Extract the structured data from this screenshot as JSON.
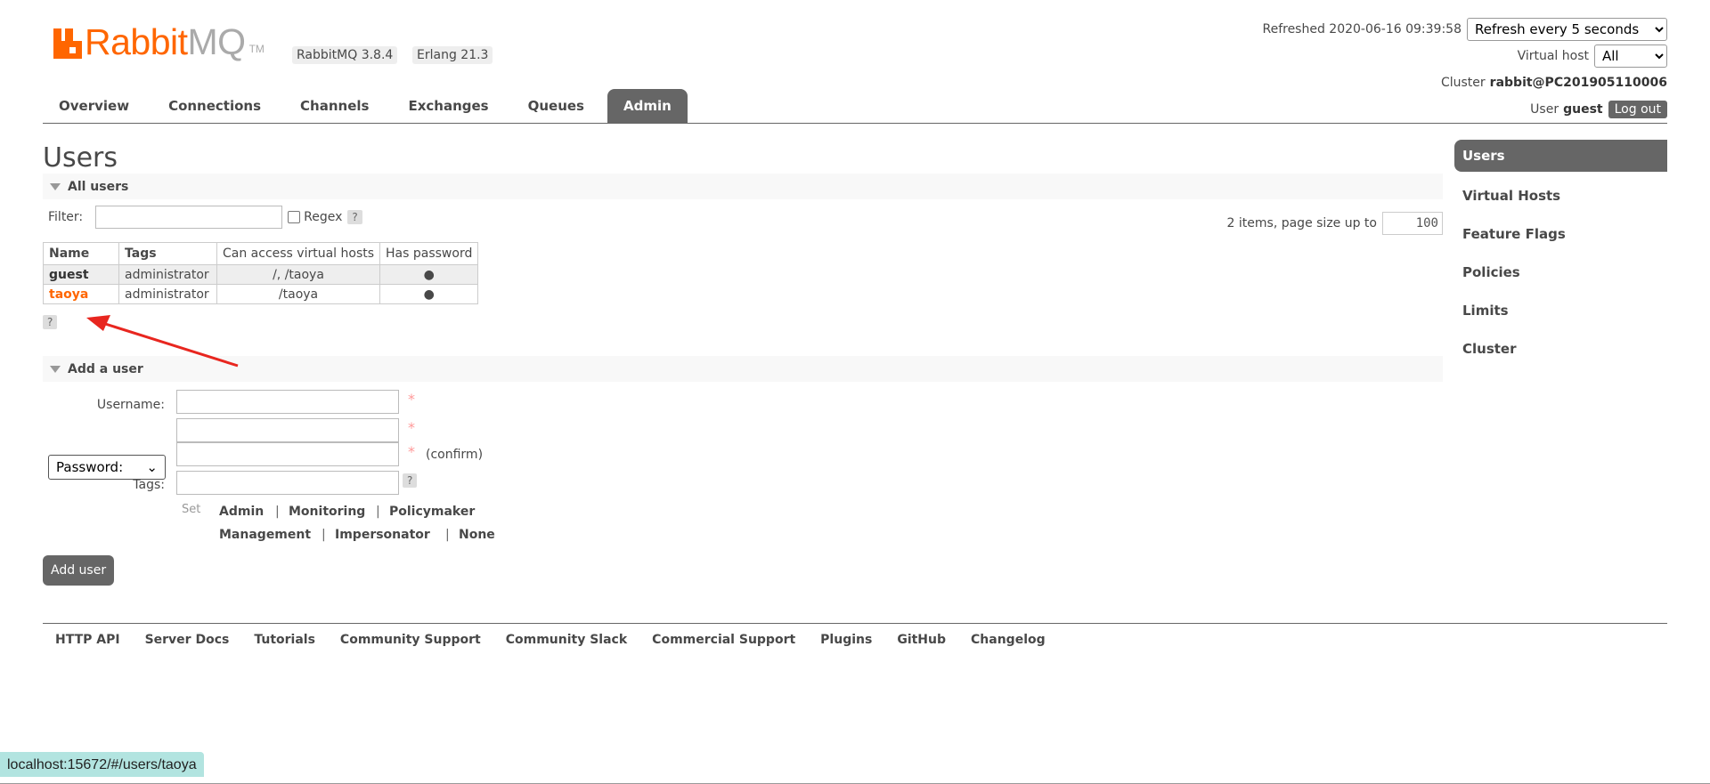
{
  "header": {
    "logo": {
      "rabbit": "Rabbit",
      "mq": "MQ",
      "tm": "TM"
    },
    "rabbitmq_version": "RabbitMQ 3.8.4",
    "erlang_version": "Erlang 21.3",
    "refreshed_label": "Refreshed 2020-06-16 09:39:58",
    "refresh_select": "Refresh every 5 seconds",
    "vhost_label": "Virtual host",
    "vhost_select": "All",
    "cluster_label": "Cluster",
    "cluster_name": "rabbit@PC201905110006",
    "user_label": "User",
    "user_name": "guest",
    "logout_label": "Log out"
  },
  "tabs": [
    "Overview",
    "Connections",
    "Channels",
    "Exchanges",
    "Queues",
    "Admin"
  ],
  "page_title": "Users",
  "all_users": {
    "section_title": "All users",
    "filter_label": "Filter:",
    "filter_value": "",
    "regex_label": "Regex",
    "help": "?",
    "page_info": "2 items, page size up to",
    "page_size": "100",
    "columns": [
      "Name",
      "Tags",
      "Can access virtual hosts",
      "Has password"
    ],
    "rows": [
      {
        "name": "guest",
        "tags": "administrator",
        "vhosts": "/, /taoya",
        "has_password": "●"
      },
      {
        "name": "taoya",
        "tags": "administrator",
        "vhosts": "/taoya",
        "has_password": "●"
      }
    ]
  },
  "add_user": {
    "section_title": "Add a user",
    "username_label": "Username:",
    "password_select": "Password:",
    "confirm_label": "(confirm)",
    "tags_label": "Tags:",
    "required_mark": "*",
    "set_label": "Set",
    "tag_options": [
      "Admin",
      "Monitoring",
      "Policymaker",
      "Management",
      "Impersonator",
      "None"
    ],
    "separator": "|",
    "submit_label": "Add user"
  },
  "sidebar": [
    "Users",
    "Virtual Hosts",
    "Feature Flags",
    "Policies",
    "Limits",
    "Cluster"
  ],
  "footer": [
    "HTTP API",
    "Server Docs",
    "Tutorials",
    "Community Support",
    "Community Slack",
    "Commercial Support",
    "Plugins",
    "GitHub",
    "Changelog"
  ],
  "statusbar": "localhost:15672/#/users/taoya",
  "colors": {
    "accent": "#ff6600",
    "tab_active": "#666666",
    "annotation_arrow": "#e8261f"
  }
}
